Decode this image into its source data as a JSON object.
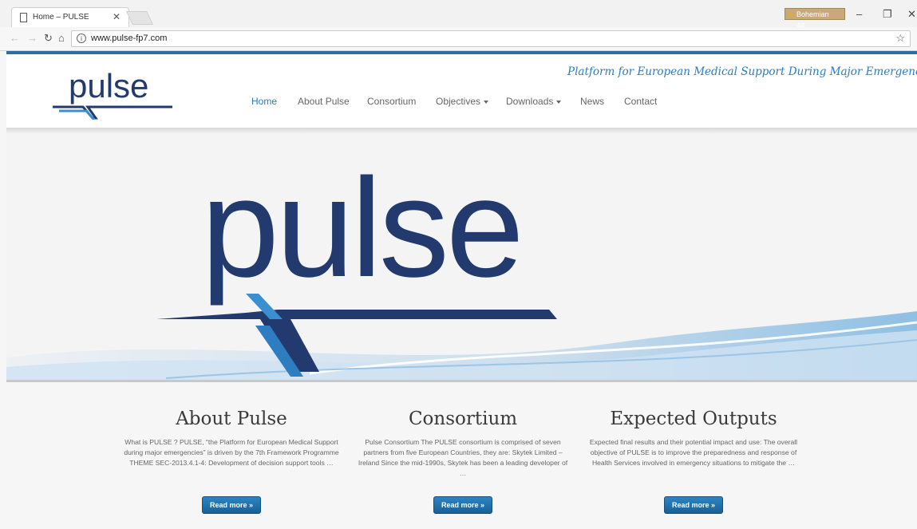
{
  "browser": {
    "tab_title": "Home – PULSE",
    "url": "www.pulse-fp7.com",
    "profile_badge": "Bohemian All..."
  },
  "site": {
    "logo_text": "pulse",
    "tagline": "Platform for European Medical Support During Major Emergencies",
    "menu": [
      {
        "label": "Home"
      },
      {
        "label": "About Pulse"
      },
      {
        "label": "Consortium"
      },
      {
        "label": "Objectives"
      },
      {
        "label": "Downloads"
      },
      {
        "label": "News"
      },
      {
        "label": "Contact"
      }
    ]
  },
  "hero": {
    "logo_text": "pulse"
  },
  "columns": [
    {
      "title": "About Pulse",
      "text": "What is PULSE ? PULSE, “the Platform for European Medical Support during major emergencies” is driven by the 7th Framework Programme THEME SEC-2013.4.1-4: Development of decision support tools …",
      "button": "Read more »"
    },
    {
      "title": "Consortium",
      "text": "Pulse Consortium The PULSE consortium is comprised of seven partners from five European Countries, they are: Skytek Limited – Ireland Since the mid-1990s, Skytek has been a leading developer of …",
      "button": "Read more »"
    },
    {
      "title": "Expected Outputs",
      "text": "Expected final results and their potential impact and use: The overall objective of PULSE is to improve the preparedness and response of Health Services involved in emergency situations to mitigate the …",
      "button": "Read more »"
    }
  ],
  "colors": {
    "brand_navy": "#223a6e",
    "brand_blue": "#2b7bbf",
    "button_blue": "#1f6fa8"
  }
}
